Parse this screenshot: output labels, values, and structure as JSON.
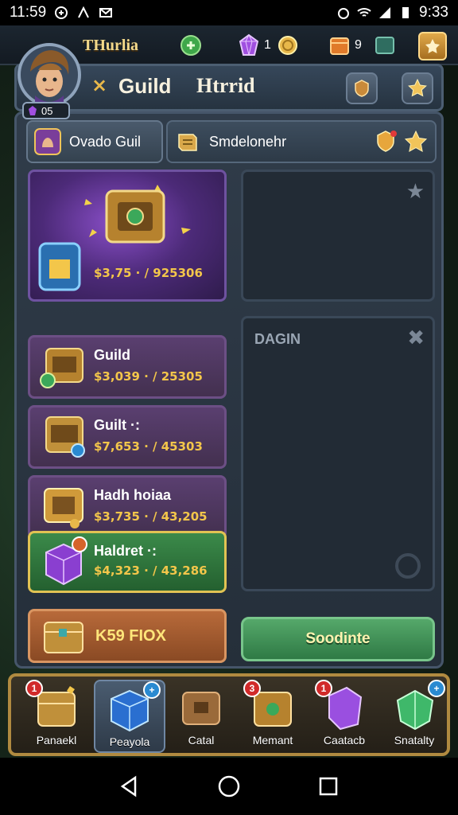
{
  "status_bar": {
    "time_left": "11:59",
    "time_right": "9:33"
  },
  "hud": {
    "player_name": "THurlia",
    "player_level": "05",
    "gems": "1",
    "crates": "9"
  },
  "header": {
    "close_symbol": "×",
    "title": "Guild",
    "subtitle": "Htrrid"
  },
  "tabs": [
    {
      "label": "Ovado Guil",
      "icon": "guild-crest-icon"
    },
    {
      "label": "Smdelonehr",
      "icon": "scroll-icon"
    }
  ],
  "cards": {
    "featured": {
      "price": "$3,75 · / 925306"
    },
    "items": [
      {
        "title": "Guild",
        "price": "$3,039 · / 25305"
      },
      {
        "title": "Guilt ·:",
        "price": "$7,653 · / 45303"
      },
      {
        "title": "Hadh hoiaa",
        "price": "$3,735 · / 43,205"
      },
      {
        "title": "Haldret ·:",
        "price": "$4,323 · / 43,286"
      }
    ],
    "orange": {
      "title": "K59 FIOX"
    }
  },
  "right": {
    "slot2_label": "DAGIN",
    "action_button": "Soodinte"
  },
  "bottom_bar": [
    {
      "label": "Panaekl",
      "badge": "1",
      "badge_color": "red",
      "active": false
    },
    {
      "label": "Peayola",
      "badge": "+",
      "badge_color": "blue",
      "active": true
    },
    {
      "label": "Catal",
      "badge": "",
      "badge_color": "",
      "active": false
    },
    {
      "label": "Memant",
      "badge": "3",
      "badge_color": "red",
      "active": false
    },
    {
      "label": "Caatacb",
      "badge": "1",
      "badge_color": "red",
      "active": false
    },
    {
      "label": "Snatalty",
      "badge": "+",
      "badge_color": "blue",
      "active": false
    }
  ],
  "colors": {
    "accent_gold": "#e8b84a",
    "price_gold": "#f3c64a",
    "green_button": "#2f7a45",
    "panel": "#303c4a"
  }
}
